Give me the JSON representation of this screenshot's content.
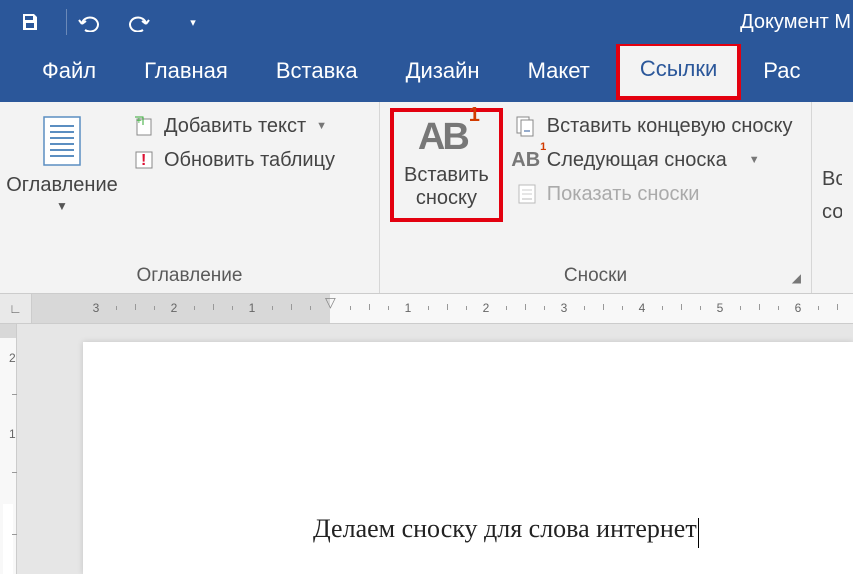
{
  "titlebar": {
    "document_name": "Документ M"
  },
  "tabs": {
    "file": "Файл",
    "home": "Главная",
    "insert": "Вставка",
    "design": "Дизайн",
    "layout": "Макет",
    "references": "Ссылки",
    "ras": "Рас"
  },
  "ribbon": {
    "toc": {
      "button": "Оглавление",
      "add_text": "Добавить текст",
      "update_table": "Обновить таблицу",
      "group_label": "Оглавление"
    },
    "footnotes": {
      "insert_footnote_line1": "Вставить",
      "insert_footnote_line2": "сноску",
      "insert_endnote": "Вставить концевую сноску",
      "next_footnote": "Следующая сноска",
      "show_notes": "Показать сноски",
      "group_label": "Сноски"
    },
    "right_cut": {
      "line1": "Вс",
      "line2": "со"
    }
  },
  "ruler": {
    "h_labels_left": [
      "3",
      "2",
      "1"
    ],
    "h_labels_right": [
      "1",
      "2",
      "3",
      "4",
      "5",
      "6"
    ]
  },
  "vruler": {
    "labels": [
      "2",
      "1"
    ]
  },
  "document": {
    "text": "Делаем сноску для слова интернет"
  }
}
